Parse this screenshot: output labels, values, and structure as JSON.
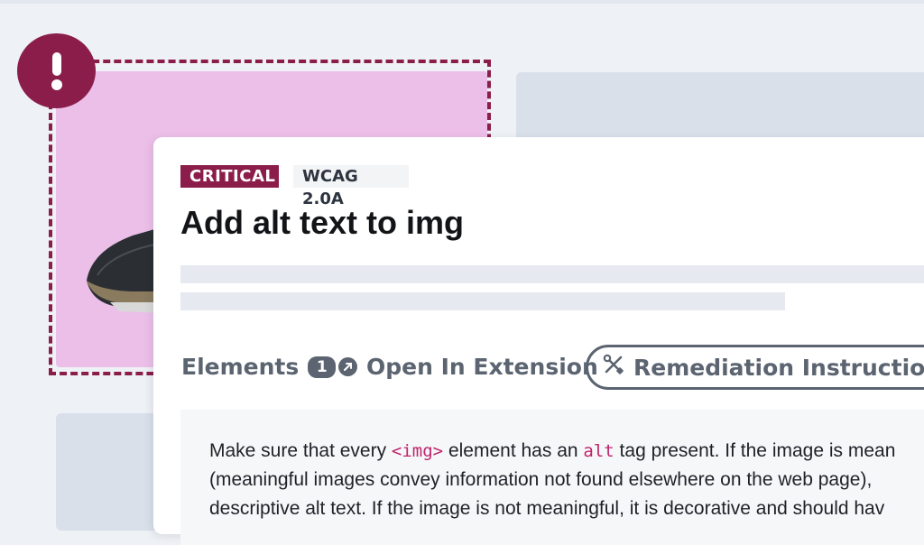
{
  "colors": {
    "page_bg": "#eef1f5",
    "critical": "#8b1d4a",
    "highlight_pink": "#ecbfe9",
    "muted_text": "#5b6470",
    "code": "#c0246c"
  },
  "alert": {
    "icon": "exclamation-icon"
  },
  "issue": {
    "severity": "CRITICAL",
    "standard": "WCAG 2.0A",
    "title": "Add alt text to img"
  },
  "tabs": {
    "elements_label": "Elements",
    "elements_count": "1",
    "open_label": "Open In Extension",
    "open_icon": "arrow-up-right-icon",
    "remediation_label": "Remediation Instructions",
    "remediation_icon": "tools-icon"
  },
  "remediation": {
    "line1_a": "Make sure that every ",
    "line1_code1": "<img>",
    "line1_b": " element has an ",
    "line1_code2": "alt",
    "line1_c": " tag present. If the image is mean",
    "line2": "(meaningful images convey information not found elsewhere on the web page),",
    "line3": "descriptive alt text. If the image is not meaningful, it is decorative and should hav"
  }
}
